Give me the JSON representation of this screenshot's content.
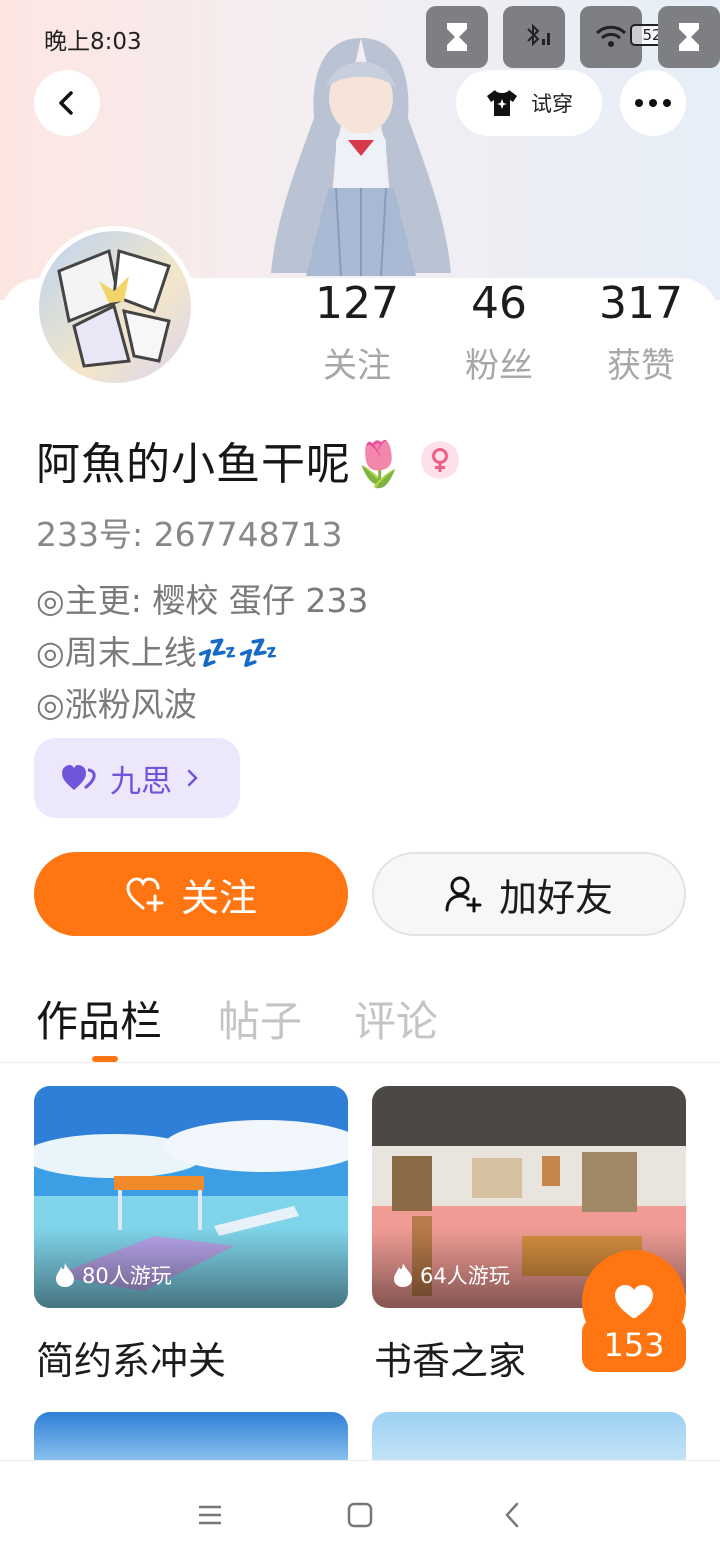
{
  "status_bar": {
    "time": "晚上8:03",
    "battery": "52"
  },
  "header": {
    "tryon_label": "试穿"
  },
  "stats": [
    {
      "value": "127",
      "label": "关注"
    },
    {
      "value": "46",
      "label": "粉丝"
    },
    {
      "value": "317",
      "label": "获赞"
    }
  ],
  "profile": {
    "name": "阿魚的小鱼干呢🌷",
    "uid": "233号: 267748713",
    "bio": [
      "◎主更: 樱校 蛋仔 233",
      "◎周末上线💤💤",
      "◎涨粉风波"
    ],
    "tag": "九思"
  },
  "actions": {
    "follow": "关注",
    "add_friend": "加好友"
  },
  "tabs": [
    "作品栏",
    "帖子",
    "评论"
  ],
  "works": [
    {
      "title": "简约系冲关",
      "plays": "80人游玩"
    },
    {
      "title": "书香之家",
      "plays": "64人游玩"
    }
  ],
  "like_count": "153",
  "colors": {
    "accent": "#ff7512",
    "tag_bg": "#ece7fb",
    "tag_text": "#6f55d9"
  }
}
